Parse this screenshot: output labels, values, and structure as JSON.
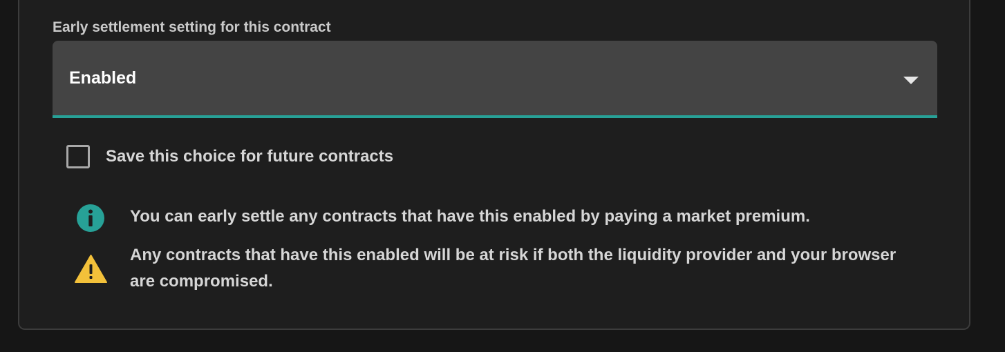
{
  "settings": {
    "field_label": "Early settlement setting for this contract",
    "select": {
      "value": "Enabled",
      "icon": "chevron-down-icon"
    },
    "save_choice": {
      "label": "Save this choice for future contracts",
      "checked": false
    },
    "notices": {
      "info": {
        "icon": "info-icon",
        "color": "#27a197",
        "text": "You can early settle any contracts that have this enabled by paying a market premium."
      },
      "warning": {
        "icon": "warning-icon",
        "color": "#f3c13a",
        "text": "Any contracts that have this enabled will be at risk if both the liquidity provider and your browser are compromised."
      }
    }
  },
  "colors": {
    "accent": "#27a197",
    "background": "#1e1e1e",
    "select_background": "#444444"
  }
}
